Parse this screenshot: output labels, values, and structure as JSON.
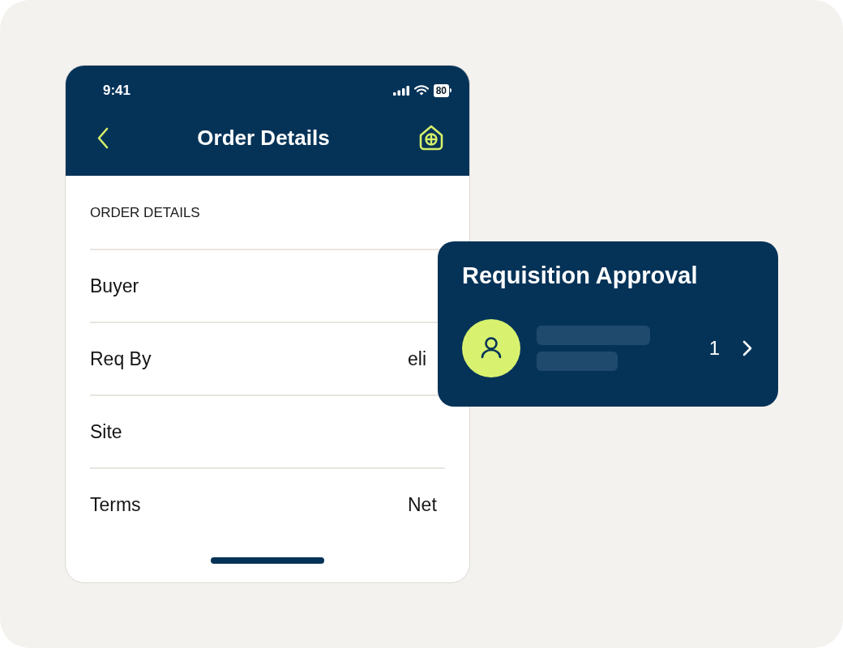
{
  "status_bar": {
    "time": "9:41",
    "battery": "80"
  },
  "nav_bar": {
    "title": "Order Details"
  },
  "section": {
    "heading": "ORDER DETAILS",
    "rows": [
      {
        "label": "Buyer"
      },
      {
        "label": "Req By",
        "value": "eli"
      },
      {
        "label": "Site"
      },
      {
        "label": "Terms",
        "value": "Net"
      }
    ]
  },
  "approval_card": {
    "title": "Requisition Approval",
    "count": "1"
  }
}
